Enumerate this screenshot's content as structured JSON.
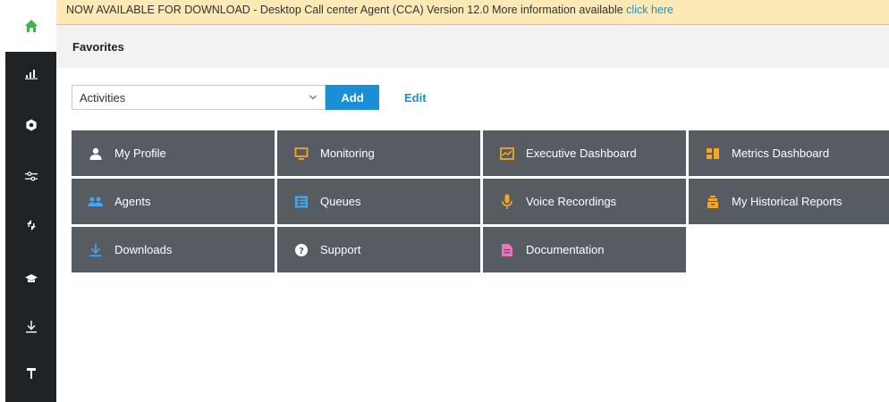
{
  "banner": {
    "text": "NOW AVAILABLE FOR DOWNLOAD - Desktop Call center Agent (CCA) Version 12.0 More information available ",
    "link": "click here"
  },
  "favorites": {
    "title": "Favorites"
  },
  "controls": {
    "select_value": "Activities",
    "add_label": "Add",
    "edit_label": "Edit"
  },
  "tiles": [
    {
      "label": "My Profile",
      "icon": "user-icon",
      "color": "#ffffff"
    },
    {
      "label": "Monitoring",
      "icon": "monitor-icon",
      "color": "#f5a623"
    },
    {
      "label": "Executive Dashboard",
      "icon": "chart-icon",
      "color": "#f5a623"
    },
    {
      "label": "Metrics Dashboard",
      "icon": "dashboard-icon",
      "color": "#f5a623"
    },
    {
      "label": "Agents",
      "icon": "agents-icon",
      "color": "#3fa9f5"
    },
    {
      "label": "Queues",
      "icon": "list-icon",
      "color": "#3fa9f5"
    },
    {
      "label": "Voice Recordings",
      "icon": "microphone-icon",
      "color": "#f5a623"
    },
    {
      "label": "My Historical Reports",
      "icon": "archive-icon",
      "color": "#f5a623"
    },
    {
      "label": "Downloads",
      "icon": "download-icon",
      "color": "#3fa9f5"
    },
    {
      "label": "Support",
      "icon": "help-icon",
      "color": "#ffffff"
    },
    {
      "label": "Documentation",
      "icon": "document-icon",
      "color": "#f06fc0"
    }
  ],
  "colors": {
    "sidebar": "#1f2326",
    "accent": "#1a8fd8",
    "home_icon": "#3db54a",
    "tile_bg": "#575c63",
    "banner_bg": "#fde9b5"
  }
}
